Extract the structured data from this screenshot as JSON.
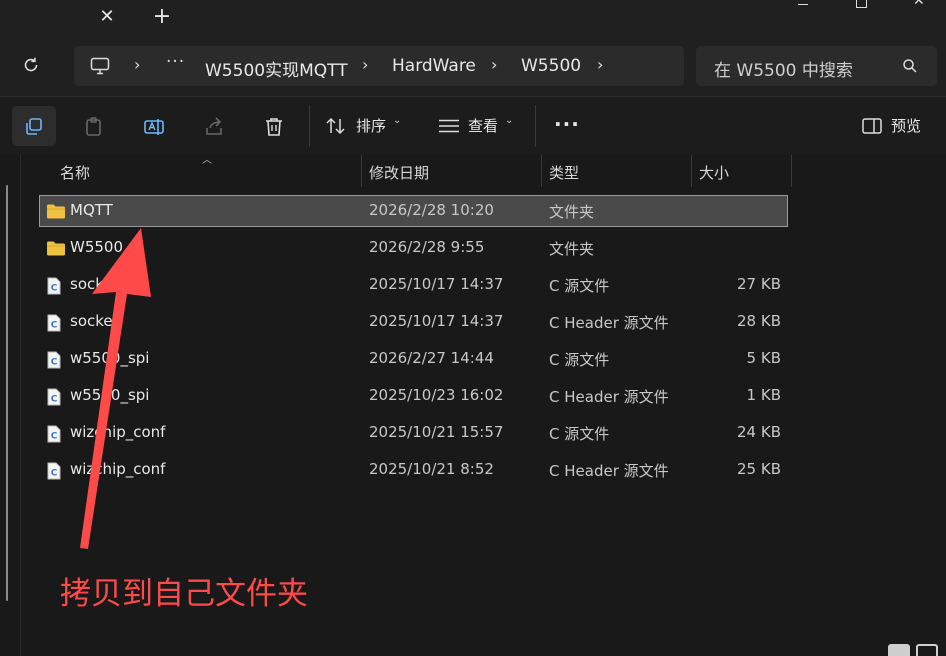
{
  "titlebar": {
    "close_tab_glyph": "✕",
    "new_tab_glyph": "+"
  },
  "address": {
    "breadcrumbs": [
      "W5500实现MQTT",
      "HardWare",
      "W5500"
    ],
    "ellipsis": "···"
  },
  "search": {
    "placeholder": "在 W5500 中搜索"
  },
  "toolbar": {
    "sort_label": "排序",
    "view_label": "查看",
    "more_label": "···",
    "preview_label": "预览"
  },
  "columns": {
    "name": "名称",
    "date": "修改日期",
    "type": "类型",
    "size": "大小"
  },
  "files": [
    {
      "name": "MQTT",
      "date": "2026/2/28 10:20",
      "type": "文件夹",
      "size": "",
      "icon": "folder-icon",
      "selected": true
    },
    {
      "name": "W5500",
      "date": "2026/2/28 9:55",
      "type": "文件夹",
      "size": "",
      "icon": "folder-icon",
      "selected": false
    },
    {
      "name": "socket",
      "date": "2025/10/17 14:37",
      "type": "C 源文件",
      "size": "27 KB",
      "icon": "c-file-icon",
      "selected": false
    },
    {
      "name": "socket",
      "date": "2025/10/17 14:37",
      "type": "C Header 源文件",
      "size": "28 KB",
      "icon": "c-file-icon",
      "selected": false
    },
    {
      "name": "w5500_spi",
      "date": "2026/2/27 14:44",
      "type": "C 源文件",
      "size": "5 KB",
      "icon": "c-file-icon",
      "selected": false
    },
    {
      "name": "w5500_spi",
      "date": "2025/10/23 16:02",
      "type": "C Header 源文件",
      "size": "1 KB",
      "icon": "c-file-icon",
      "selected": false
    },
    {
      "name": "wizchip_conf",
      "date": "2025/10/21 15:57",
      "type": "C 源文件",
      "size": "24 KB",
      "icon": "c-file-icon",
      "selected": false
    },
    {
      "name": "wizchip_conf",
      "date": "2025/10/21 8:52",
      "type": "C Header 源文件",
      "size": "25 KB",
      "icon": "c-file-icon",
      "selected": false
    }
  ],
  "annotation": {
    "text": "拷贝到自己文件夹",
    "color": "#ff4a4a"
  },
  "colors": {
    "background": "#191919",
    "selection": "#4a4a4a",
    "folder": "#f0c040",
    "annotation_arrow": "#ff4a4a"
  }
}
